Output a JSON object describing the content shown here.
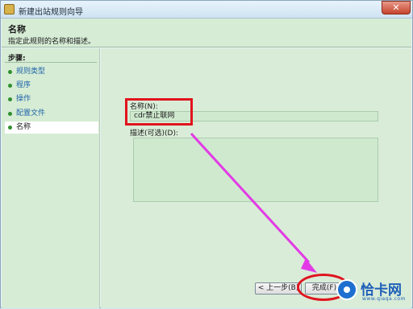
{
  "window": {
    "title": "新建出站规则向导",
    "close_glyph": "✕"
  },
  "header": {
    "title": "名称",
    "description": "指定此规则的名称和描述。"
  },
  "steps": {
    "title": "步骤:",
    "items": [
      {
        "label": "规则类型"
      },
      {
        "label": "程序"
      },
      {
        "label": "操作"
      },
      {
        "label": "配置文件"
      },
      {
        "label": "名称"
      }
    ]
  },
  "form": {
    "name_label": "名称(N):",
    "name_value": "cdr禁止联网",
    "description_label": "描述(可选)(D):",
    "description_value": ""
  },
  "buttons": {
    "back_label": "< 上一步(B)",
    "finish_label": "完成(F)"
  },
  "watermark": {
    "text": "恰卡网",
    "sub": "www.qiaqa.com"
  },
  "colors": {
    "annotation_red": "#e0141e",
    "annotation_arrow": "#e23be6",
    "step_link": "#1f63a8",
    "panel_green": "#d6ecd5"
  },
  "icons": {
    "app": "firewall-wizard-icon",
    "step_bullet": "green-dot-icon",
    "close": "close-icon"
  }
}
